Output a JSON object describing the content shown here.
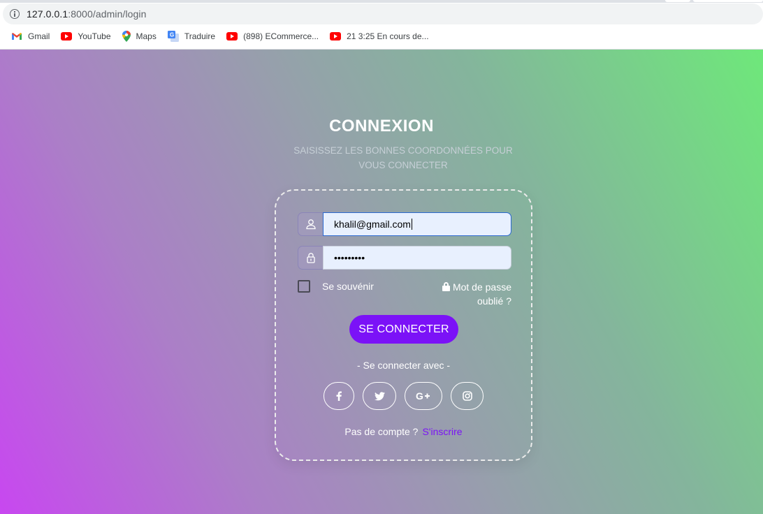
{
  "browser": {
    "url_host": "127.0.0.1",
    "url_path": ":8000/admin/login",
    "bookmarks": [
      {
        "label": "Gmail",
        "icon": "gmail-icon"
      },
      {
        "label": "YouTube",
        "icon": "youtube-icon"
      },
      {
        "label": "Maps",
        "icon": "maps-icon"
      },
      {
        "label": "Traduire",
        "icon": "translate-icon"
      },
      {
        "label": "(898) ECommerce...",
        "icon": "youtube-icon"
      },
      {
        "label": "21 3:25 En cours de...",
        "icon": "youtube-icon"
      }
    ]
  },
  "login": {
    "title": "CONNEXION",
    "subtitle": "SAISISSEZ LES BONNES COORDONNÉES POUR VOUS CONNECTER",
    "email_value": "khalil@gmail.com",
    "password_value": "•••••••••",
    "remember_label": "Se souvénir",
    "forgot_label": "Mot de passe oublié ?",
    "submit_label": "SE CONNECTER",
    "social_caption": "- Se connecter avec -",
    "social": [
      {
        "name": "facebook",
        "glyph": "f"
      },
      {
        "name": "twitter",
        "glyph": "t"
      },
      {
        "name": "google-plus",
        "glyph": "G+"
      },
      {
        "name": "instagram",
        "glyph": "ig"
      }
    ],
    "no_account": "Pas de compte ?",
    "signup_label": "S'inscrire"
  },
  "colors": {
    "accent": "#7b12f7",
    "gradient_start": "#c847f0",
    "gradient_end": "#6ee87a"
  }
}
